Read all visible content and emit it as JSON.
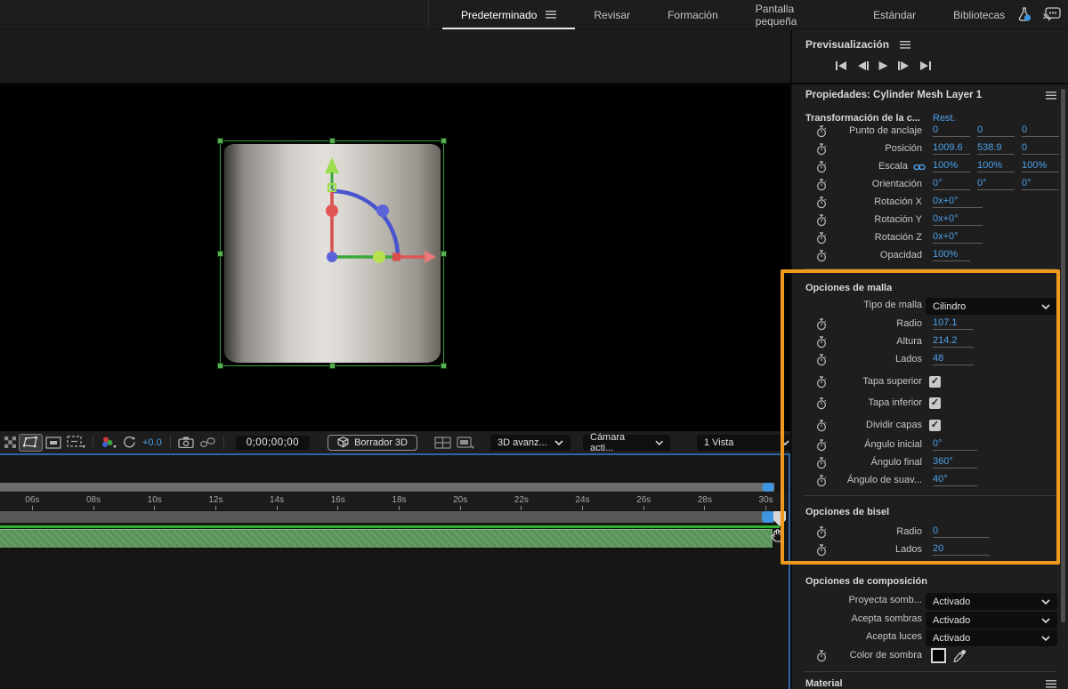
{
  "topbar": {
    "tabs": [
      "Predeterminado",
      "Revisar",
      "Formación",
      "Pantalla pequeña",
      "Estándar",
      "Bibliotecas"
    ],
    "overflow": "»"
  },
  "preview": {
    "title": "Previsualización"
  },
  "properties": {
    "title": "Propiedades: Cylinder Mesh Layer 1",
    "transform_header": "Transformación de la c...",
    "reset_label": "Rest.",
    "transform_rows": [
      {
        "label": "Punto de anclaje",
        "values": [
          "0",
          "0",
          "0"
        ]
      },
      {
        "label": "Posición",
        "values": [
          "1009.6",
          "538.9",
          "0"
        ]
      },
      {
        "label": "Escala",
        "values": [
          "100%",
          "100%",
          "100%"
        ]
      },
      {
        "label": "Orientación",
        "values": [
          "0°",
          "0°",
          "0°"
        ]
      },
      {
        "label": "Rotación X",
        "values": [
          "0x+0°"
        ]
      },
      {
        "label": "Rotación Y",
        "values": [
          "0x+0°"
        ]
      },
      {
        "label": "Rotación Z",
        "values": [
          "0x+0°"
        ]
      },
      {
        "label": "Opacidad",
        "values": [
          "100%"
        ]
      }
    ],
    "mesh": {
      "header": "Opciones de malla",
      "type_label": "Tipo de malla",
      "type_value": "Cilindro",
      "value_rows": [
        {
          "label": "Radio",
          "value": "107.1"
        },
        {
          "label": "Altura",
          "value": "214.2"
        },
        {
          "label": "Lados",
          "value": "48"
        }
      ],
      "check_rows": [
        {
          "label": "Tapa superior",
          "checked": true
        },
        {
          "label": "Tapa inferior",
          "checked": true
        },
        {
          "label": "Dividir capas",
          "checked": true
        }
      ],
      "angle_rows": [
        {
          "label": "Ángulo inicial",
          "value": "0°"
        },
        {
          "label": "Ángulo final",
          "value": "360°"
        },
        {
          "label": "Ángulo de suav...",
          "value": "40°"
        }
      ]
    },
    "bevel": {
      "header": "Opciones de bisel",
      "rows": [
        {
          "label": "Radio",
          "value": "0"
        },
        {
          "label": "Lados",
          "value": "20"
        }
      ]
    },
    "composition": {
      "header": "Opciones de composición",
      "rows": [
        {
          "label": "Proyecta somb...",
          "value": "Activado"
        },
        {
          "label": "Acepta sombras",
          "value": "Activado"
        },
        {
          "label": "Acepta luces",
          "value": "Activado"
        }
      ],
      "shadow_label": "Color de sombra"
    },
    "material_header": "Material"
  },
  "viewer_toolbar": {
    "exposure_value": "+0.0",
    "timecode": "0;00;00;00",
    "draft_button": "Borrador 3D",
    "renderer_dropdown": "3D avanz...",
    "camera_dropdown": "Cámara acti...",
    "view_dropdown": "1 Vista"
  },
  "timeline": {
    "ticks": [
      "06s",
      "08s",
      "10s",
      "12s",
      "14s",
      "16s",
      "18s",
      "20s",
      "22s",
      "24s",
      "26s",
      "28s",
      "30s"
    ]
  },
  "colors": {
    "accent_blue": "#4da0e8",
    "highlight_orange": "#f0991e",
    "panel_border_blue": "#2e64a3",
    "cached_green": "#5f9b5f"
  }
}
